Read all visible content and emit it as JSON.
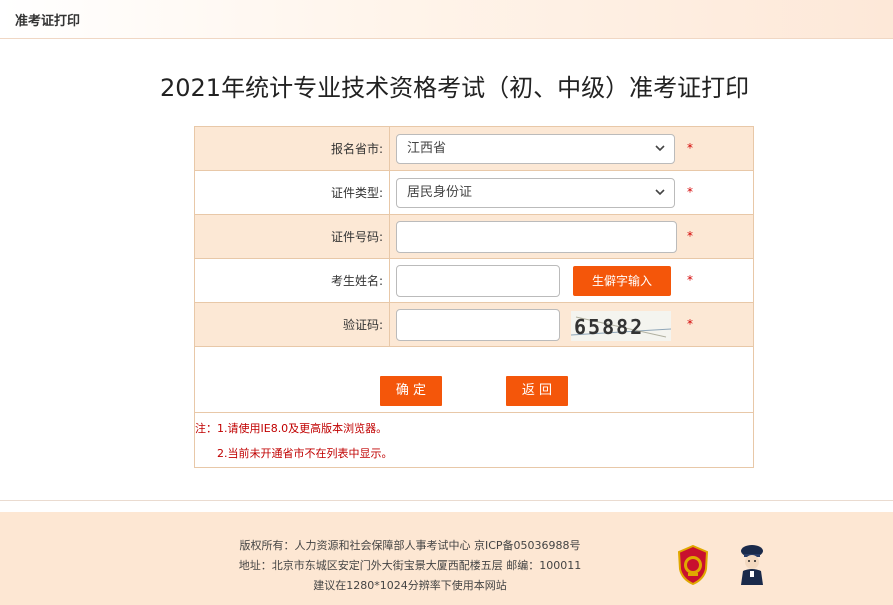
{
  "header": {
    "title": "准考证打印"
  },
  "page": {
    "title": "2021年统计专业技术资格考试（初、中级）准考证打印"
  },
  "form": {
    "province_label": "报名省市:",
    "province_value": "江西省",
    "id_type_label": "证件类型:",
    "id_type_value": "居民身份证",
    "id_number_label": "证件号码:",
    "id_number_value": "",
    "name_label": "考生姓名:",
    "name_value": "",
    "rare_char_button": "生僻字输入",
    "captcha_label": "验证码:",
    "captcha_value": "",
    "captcha_text": "65882",
    "required_mark": "*",
    "confirm_button": "确 定",
    "back_button": "返 回"
  },
  "notes": {
    "note1": "注：1.请使用IE8.0及更高版本浏览器。",
    "note2": "2.当前未开通省市不在列表中显示。"
  },
  "footer": {
    "line1": "版权所有：人力资源和社会保障部人事考试中心 京ICP备05036988号",
    "line2": "地址：北京市东城区安定门外大街宝景大厦西配楼五层 邮编：100011",
    "line3": "建议在1280*1024分辨率下使用本网站"
  },
  "colors": {
    "accent": "#f4560a",
    "required": "#d40000",
    "row_fill": "#fce8d5",
    "footer_bg": "#fde7d3"
  },
  "icons": [
    "chevron-down-icon",
    "police-emblem-icon",
    "cyber-police-icon"
  ]
}
